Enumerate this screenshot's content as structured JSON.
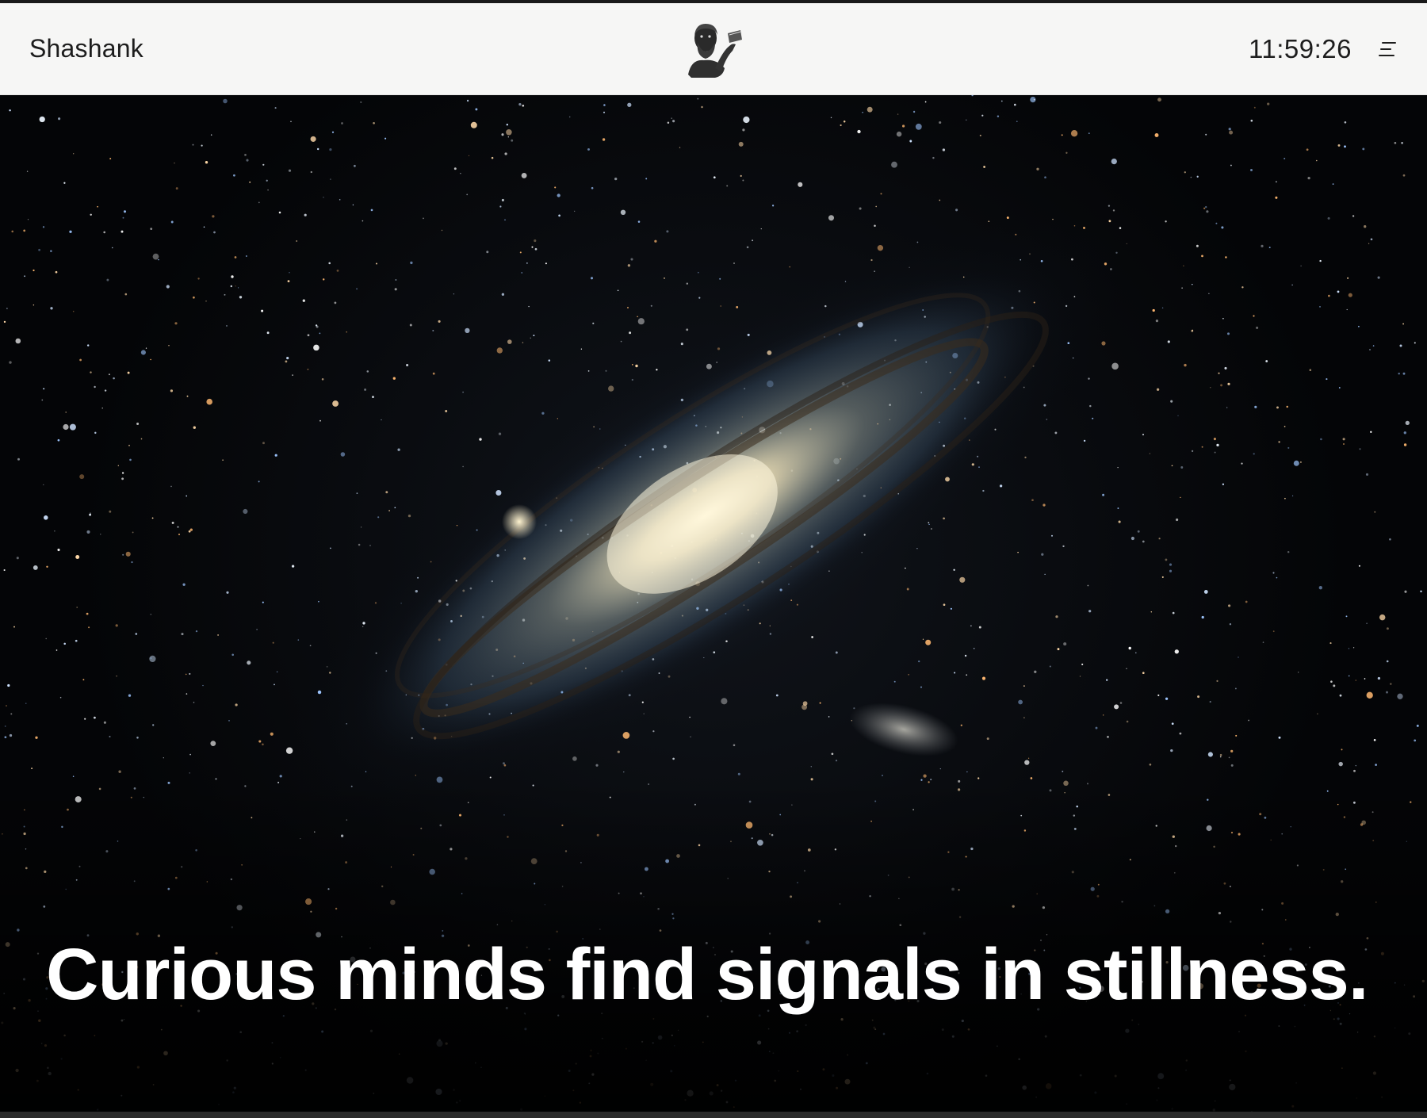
{
  "header": {
    "brand": "Shashank",
    "logo_icon": "philosopher-bust-logo-icon",
    "clock": "11:59:26",
    "menu_icon": "menu-lines-icon"
  },
  "hero": {
    "image": "andromeda-galaxy-starfield",
    "tagline": "Curious minds find signals in stillness."
  },
  "colors": {
    "header_bg": "#f6f6f5",
    "text_dark": "#1d1d1d",
    "hero_bg": "#050608",
    "tagline": "#ffffff"
  }
}
